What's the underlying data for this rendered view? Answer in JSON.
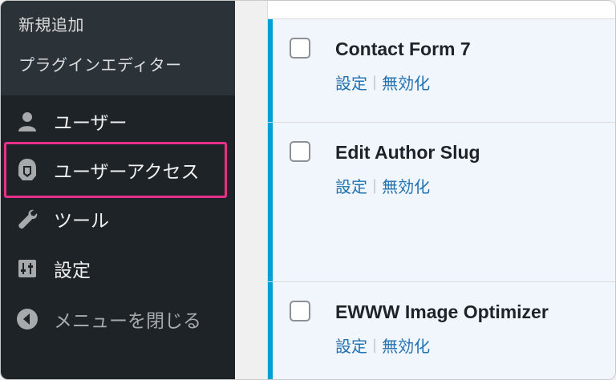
{
  "sidebar": {
    "submenu": [
      "新規追加",
      "プラグインエディター"
    ],
    "items": [
      {
        "label": "ユーザー",
        "icon": "user-icon"
      },
      {
        "label": "ユーザーアクセス",
        "icon": "user-access-icon"
      },
      {
        "label": "ツール",
        "icon": "wrench-icon"
      },
      {
        "label": "設定",
        "icon": "settings-icon"
      },
      {
        "label": "メニューを閉じる",
        "icon": "collapse-icon"
      }
    ]
  },
  "plugins": [
    {
      "name": "Contact Form 7",
      "settings": "設定",
      "deactivate": "無効化"
    },
    {
      "name": "Edit Author Slug",
      "settings": "設定",
      "deactivate": "無効化"
    },
    {
      "name": "EWWW Image Optimizer",
      "settings": "設定",
      "deactivate": "無効化"
    }
  ],
  "colors": {
    "sidebar_bg": "#1d2327",
    "submenu_bg": "#2c3338",
    "highlight": "#e6308a",
    "active_bar": "#00a0d2",
    "link": "#2271b1"
  }
}
